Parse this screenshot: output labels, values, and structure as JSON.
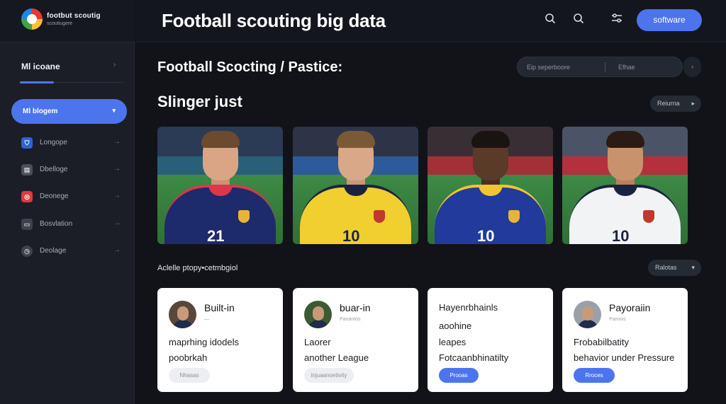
{
  "brand": {
    "name": "footbut scoutig",
    "subtitle": "scoutiugere"
  },
  "topbar": {
    "title": "Football scouting big data",
    "icons": [
      "search-icon",
      "search-icon",
      "filter-icon"
    ],
    "software_label": "software"
  },
  "sidebar": {
    "heading": "Ml icoane",
    "active_item": "Ml blogem",
    "items": [
      {
        "label": "Longope",
        "icon": "shield-icon",
        "color": "#2f63d6"
      },
      {
        "label": "Dbelloge",
        "icon": "grid-icon",
        "color": "#4a4f58"
      },
      {
        "label": "Deonege",
        "icon": "target-icon",
        "color": "#e03a3a"
      },
      {
        "label": "Bosvlation",
        "icon": "document-icon",
        "color": "#4a4f58"
      },
      {
        "label": "Deolage",
        "icon": "clock-icon",
        "color": "#4a4f58"
      }
    ]
  },
  "main": {
    "section_title": "Football Scocting / Pastice:",
    "search": {
      "left_text": "Eip seperboore",
      "right_text": "Efhae"
    },
    "subtitle": "Slinger just",
    "return_label": "Reiurna",
    "players": [
      {
        "number": "21",
        "shirt": "#1d2a6b",
        "trim": "#e0364a",
        "skin": "#d9a584",
        "hair": "#6b4a2e",
        "crowd": "#2b3a55",
        "board": "#2a5f78"
      },
      {
        "number": "10",
        "shirt": "#f1cf2f",
        "trim": "#1b2241",
        "skin": "#d8a888",
        "hair": "#7a5a36",
        "crowd": "#2d3448",
        "board": "#2d5a9a"
      },
      {
        "number": "10",
        "shirt": "#213a9c",
        "trim": "#f0c530",
        "skin": "#5a3a28",
        "hair": "#1a1411",
        "crowd": "#3a2e35",
        "board": "#a43037"
      },
      {
        "number": "10",
        "shirt": "#f2f3f5",
        "trim": "#1b2241",
        "skin": "#c8936c",
        "hair": "#2a1c14",
        "crowd": "#4a5466",
        "board": "#b3303c"
      }
    ],
    "section2_label": "Aclelle ptopy•cetmbgiol",
    "section2_button": "Ralotas",
    "cards": [
      {
        "name": "Built-in",
        "sub": "—",
        "lines": [
          "maprhing idodels",
          "poobrkah"
        ],
        "tag": "Nhasas",
        "tag_style": "grey"
      },
      {
        "name": "buar-in",
        "sub": "Panantos",
        "lines": [
          "Laorer",
          "another League"
        ],
        "tag": "injuaanoetivity",
        "tag_style": "grey"
      },
      {
        "name": "",
        "sub": "",
        "lines": [
          "Hayenrbhainls",
          "aoohine",
          "leapes",
          "Fotcaanbhinatilty"
        ],
        "tag": "Prooas",
        "tag_style": "blue"
      },
      {
        "name": "Payoraiin",
        "sub": "Panoos",
        "lines": [
          "Frobabilbatity",
          "behavior under Pressure"
        ],
        "tag": "Rroces",
        "tag_style": "blue"
      }
    ]
  }
}
